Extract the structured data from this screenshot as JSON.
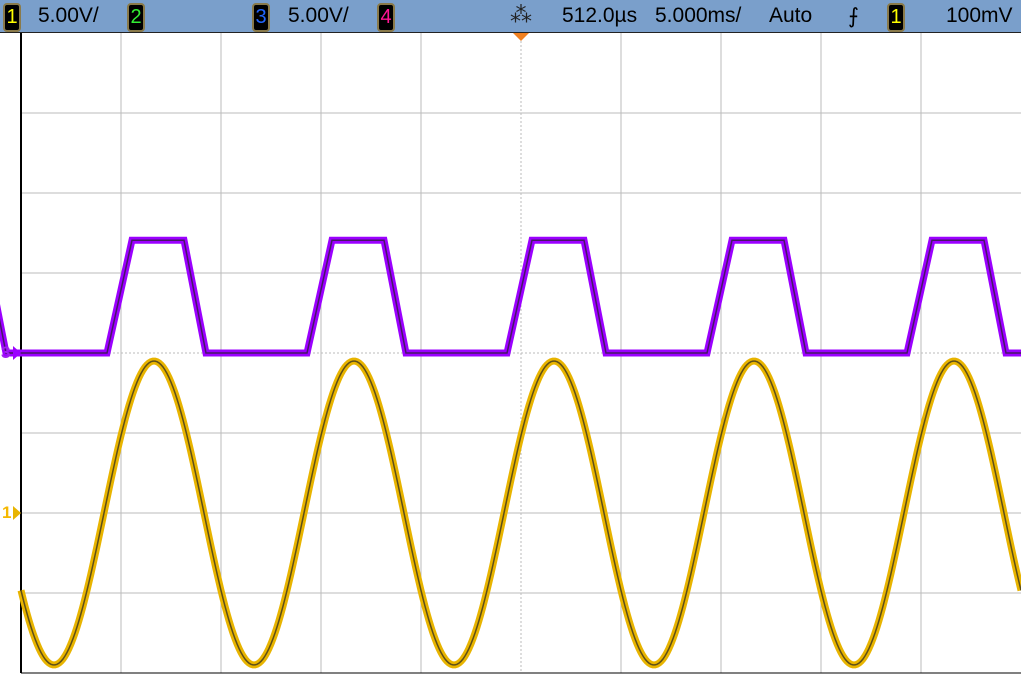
{
  "header": {
    "ch1": {
      "label": "1",
      "scale": "5.00V/",
      "color": "#ffff00"
    },
    "ch2": {
      "label": "2",
      "color": "#33ee33"
    },
    "ch3": {
      "label": "3",
      "scale": "5.00V/",
      "color": "#2266ff"
    },
    "ch4": {
      "label": "4",
      "color": "#ff1493"
    },
    "acq_icon": "acquisition-star-icon",
    "delay": "512.0µs",
    "timebase": "5.000ms/",
    "trigger_mode": "Auto",
    "trigger_slope_icon": "rising-edge-icon",
    "trigger_source": "1",
    "trigger_level": "100mV"
  },
  "markers": {
    "ch3": "3",
    "ch1": "1"
  },
  "chart_data": {
    "type": "line",
    "x_unit": "ms",
    "x_per_div": 5,
    "x_divs": 10,
    "x_range": [
      -25,
      25
    ],
    "y_unit": "V",
    "y_per_div": 5,
    "y_divs": 8,
    "grid": true,
    "series": [
      {
        "name": "Channel 1",
        "shape": "sine",
        "color": "#e8b400",
        "amplitude_V": 9.5,
        "offset_V": 0,
        "period_ms": 10,
        "first_peak_ms": -18.35,
        "ground_div_from_top": 6
      },
      {
        "name": "Channel 3",
        "shape": "trapezoid",
        "color": "#9b00ff",
        "low_V": 0,
        "high_V": 7.05,
        "period_ms": 10,
        "rise_start_ms": -20.7,
        "rise_ms": 1.25,
        "high_ms": 2.6,
        "fall_ms": 1.1,
        "ground_div_from_top": 4
      }
    ]
  }
}
